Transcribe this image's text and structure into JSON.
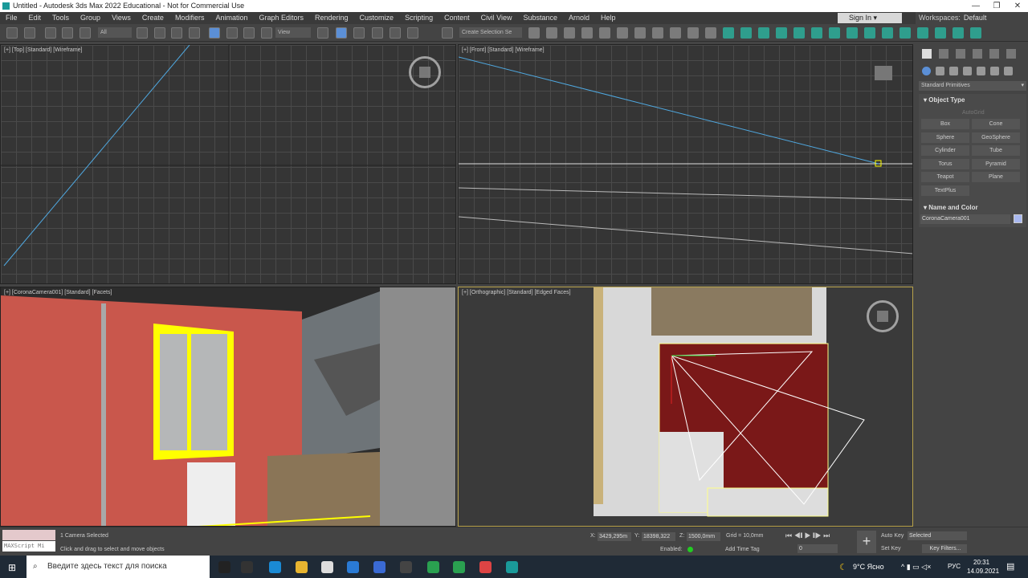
{
  "window": {
    "title": "Untitled - Autodesk 3ds Max 2022 Educational - Not for Commercial Use",
    "min": "—",
    "restore": "❐",
    "close": "✕"
  },
  "menu": [
    "File",
    "Edit",
    "Tools",
    "Group",
    "Views",
    "Create",
    "Modifiers",
    "Animation",
    "Graph Editors",
    "Rendering",
    "Customize",
    "Scripting",
    "Content",
    "Civil View",
    "Substance",
    "Arnold",
    "Help"
  ],
  "signin": "Sign In",
  "workspaces": {
    "label": "Workspaces:",
    "value": "Default"
  },
  "toolbar": {
    "filter": "All",
    "refcoord": "View",
    "selset": "Create Selection Se"
  },
  "viewports": {
    "top": "[+] [Top] [Standard] [Wireframe]",
    "front": "[+] [Front] [Standard] [Wireframe]",
    "camera": "[+] [CoronaCamera001] [Standard] [Facets]",
    "ortho": "[+] [Orthographic] [Standard] [Edged Faces]"
  },
  "command_panel": {
    "category": "Standard Primitives",
    "object_type": "Object Type",
    "autogrid": "AutoGrid",
    "buttons": [
      "Box",
      "Cone",
      "Sphere",
      "GeoSphere",
      "Cylinder",
      "Tube",
      "Torus",
      "Pyramid",
      "Teapot",
      "Plane",
      "TextPlus"
    ],
    "name_color": "Name and Color",
    "object_name": "CoronaCamera001",
    "object_color": "#a9b8f0"
  },
  "status": {
    "maxscript": "MAXScript Mi",
    "selected": "1 Camera Selected",
    "prompt": "Click and drag to select and move objects",
    "x_label": "X:",
    "x": "3429,295m",
    "y_label": "Y:",
    "y": "18398,322",
    "z_label": "Z:",
    "z": "1500,0mm",
    "grid": "Grid = 10,0mm",
    "enabled": "Enabled:",
    "add_time_tag": "Add Time Tag",
    "frame": "0",
    "auto_key": "Auto Key",
    "set_key": "Set Key",
    "selected_dd": "Selected",
    "key_filters": "Key Filters..."
  },
  "taskbar": {
    "search": "Введите здесь текст для поиска",
    "weather": "9°C  Ясно",
    "lang": "РУС",
    "time": "20:31",
    "date": "14.09.2021"
  },
  "toolbar_icons": [
    "undo-icon",
    "redo-icon",
    "link-icon",
    "unlink-icon",
    "bind-spacewarp-icon",
    "select-object-icon",
    "select-by-name-icon",
    "rect-selection-icon",
    "window-crossing-icon",
    "move-icon",
    "rotate-icon",
    "scale-icon",
    "placement-icon",
    "mirror-icon",
    "pivot-icon",
    "snap-icon",
    "angle-snap-icon",
    "percent-snap-icon",
    "spinner-snap-icon",
    "edit-named-sel-icon"
  ],
  "toolbar_icons_right": [
    "mirror-tool-icon",
    "align-icon",
    "scene-explorer-icon",
    "layer-explorer-icon",
    "ribbon-icon",
    "curve-editor-icon",
    "schematic-icon",
    "material-editor-icon",
    "render-setup-icon",
    "rendered-frame-icon",
    "render-icon",
    "camera-icon",
    "camera-add-icon",
    "light-icon",
    "sun-icon",
    "tree-icon",
    "tree2-icon",
    "list-icon",
    "phone-icon",
    "gear-icon",
    "frame-icon",
    "bulb-icon",
    "window-icon",
    "window2-icon",
    "grid-icon",
    "teapot-icon"
  ]
}
